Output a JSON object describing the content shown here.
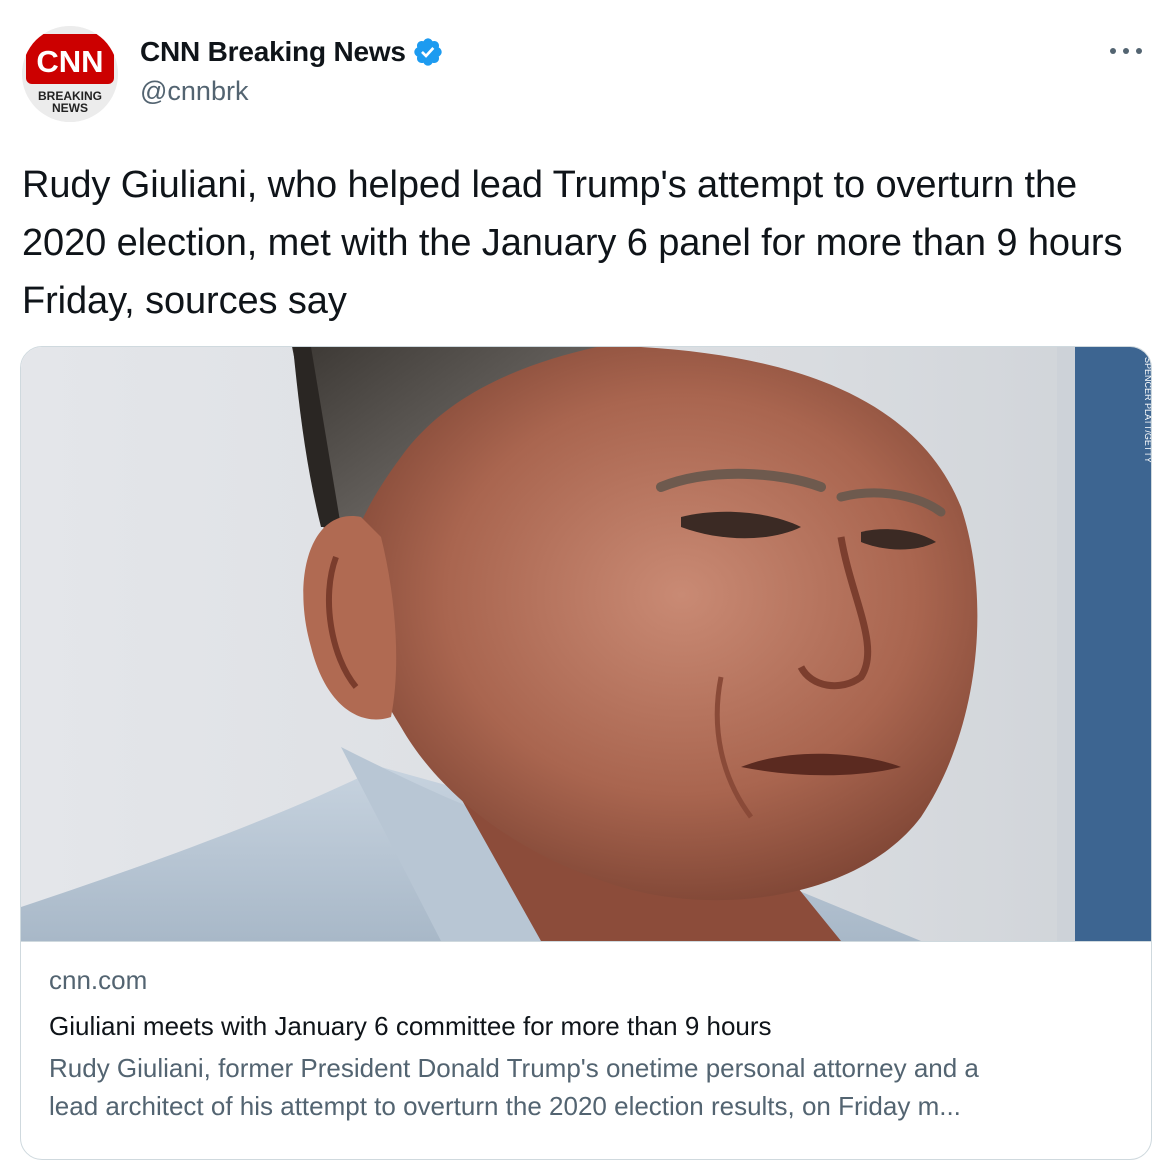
{
  "header": {
    "display_name": "CNN Breaking News",
    "handle": "@cnnbrk",
    "avatar": {
      "logo_text": "CNN",
      "sub_line_1": "BREAKING",
      "sub_line_2": "NEWS",
      "brand_color": "#cc0000"
    },
    "verified_icon": "verified-badge-icon",
    "more_icon": "more-options-icon"
  },
  "tweet": {
    "text": "Rudy Giuliani, who helped lead Trump's attempt to overturn the 2020 election, met with the January 6 panel for more than 9 hours Friday, sources say"
  },
  "card": {
    "image_credit": "SPENCER PLATT/GETTY",
    "domain": "cnn.com",
    "title": "Giuliani meets with January 6 committee for more than 9 hours",
    "description_line_1": "Rudy Giuliani, former President Donald Trump's onetime personal attorney and a",
    "description_line_2": "lead architect of his attempt to overturn the 2020 election results, on Friday m..."
  },
  "colors": {
    "verified_blue": "#1d9bf0",
    "secondary_text": "#536471",
    "border": "#cfd9de"
  }
}
